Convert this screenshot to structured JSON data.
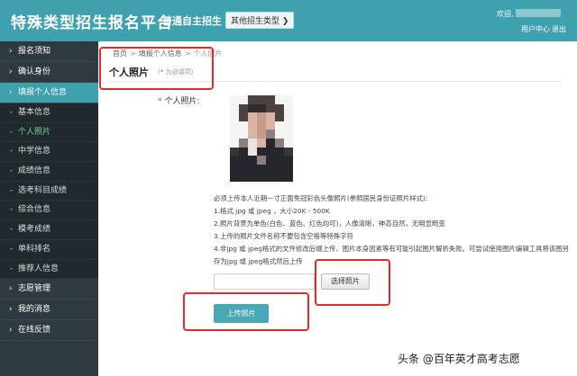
{
  "header": {
    "site_title": "特殊类型招生报名平台",
    "subtitle": "普通自主招生",
    "other_type_label": "其他招生类型",
    "welcome": "欢迎,",
    "user_center": "用户中心",
    "logout": "退出"
  },
  "sidebar": {
    "top_items": [
      {
        "label": "报名须知"
      },
      {
        "label": "确认身份"
      },
      {
        "label": "填报个人信息"
      }
    ],
    "sub_items": [
      {
        "label": "基本信息"
      },
      {
        "label": "个人照片"
      },
      {
        "label": "中学信息"
      },
      {
        "label": "成绩信息"
      },
      {
        "label": "选考科目成绩"
      },
      {
        "label": "综合信息"
      },
      {
        "label": "模考成绩"
      },
      {
        "label": "单科排名"
      },
      {
        "label": "推荐人信息"
      }
    ],
    "bottom_items": [
      {
        "label": "志愿管理"
      },
      {
        "label": "我的消息"
      },
      {
        "label": "在线反馈"
      }
    ]
  },
  "breadcrumb": {
    "home": "首页",
    "section": "填报个人信息",
    "current": "个人照片"
  },
  "page": {
    "title": "个人照片",
    "required_note": "为必填项",
    "field_label": "个人照片:"
  },
  "instructions": [
    "必须上传本人近期一寸正面免冠彩色头像照片(参照居民身份证照片样式):",
    "1.格式 jpg 或 jpeg ，大小20K - 500K",
    "2.照片背景为单色(白色、蓝色、红色均可)，人像清晰，神态自然，无明显畸变",
    "3.上传的照片文件名称不要包含空格等特殊字符",
    "4.非jpg 或 jpeg格式的文件修改后缀上传、图片本身因素等有可能引起图片解析失败。可尝试使用图片编辑工具将该图另存为jpg 或 jpeg格式然后上传"
  ],
  "buttons": {
    "choose_photo": "选择照片",
    "upload_photo": "上传照片"
  },
  "watermark": "头条 @百年英才高考志愿",
  "colors": {
    "header_bg": "#3fa0ae",
    "sidebar_bg": "#2e3a3f",
    "active_nav": "#3fa0ae",
    "annotation_red": "#e8282c"
  }
}
